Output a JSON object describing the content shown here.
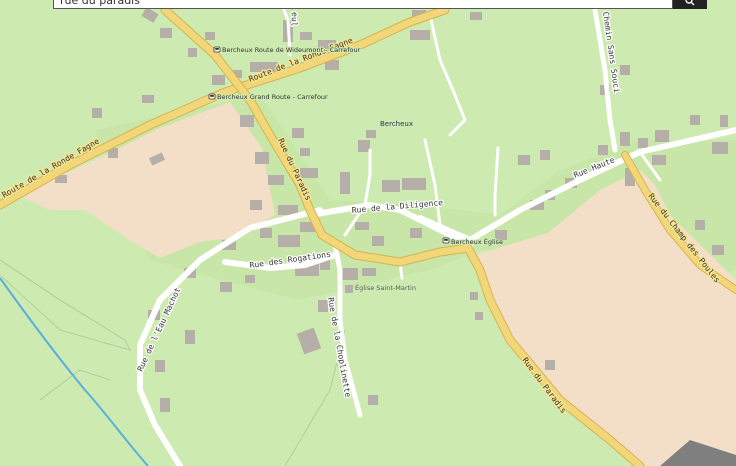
{
  "search": {
    "value": "rue du paradis"
  },
  "colors": {
    "background": "#cdebb0",
    "farmland": "#f3dfc7",
    "residential": "#c8e6a8",
    "building": "#b6afa9",
    "major_road": "#e7c86a",
    "minor_road": "#ffffff",
    "water": "#5aaede"
  },
  "labels": {
    "road_route_ronde_fagne": "Route de la Ronde Fagne",
    "road_route_ronde_fagne_2": "Route de la Ronde Fagne",
    "road_rue_paradis_north": "Rue du Paradis",
    "road_rue_paradis_south": "Rue du Paradis",
    "road_diligence": "Rue de la Diligence",
    "road_rogations": "Rue des Rogations",
    "road_eau_machot": "Rue de l'Eau Machot",
    "road_choplinette": "Rue de la Choplinette",
    "road_haute": "Rue Haute",
    "road_champ_poules": "Rue du Champ des Poules",
    "road_chemin_sans_souci": "Chemin Sans Souci",
    "road_top_fragment": "eul",
    "place_bercheux": "Bercheux",
    "poi_church": "Église Saint-Martin",
    "stop_wideumont": "Bercheux Route de Wideumont - Carrefour",
    "stop_grand_route": "Bercheux Grand Route - Carrefour",
    "stop_eglise": "Bercheux Église"
  },
  "icons": {
    "search": "search-icon",
    "bus_stop": "bus-stop-icon"
  }
}
